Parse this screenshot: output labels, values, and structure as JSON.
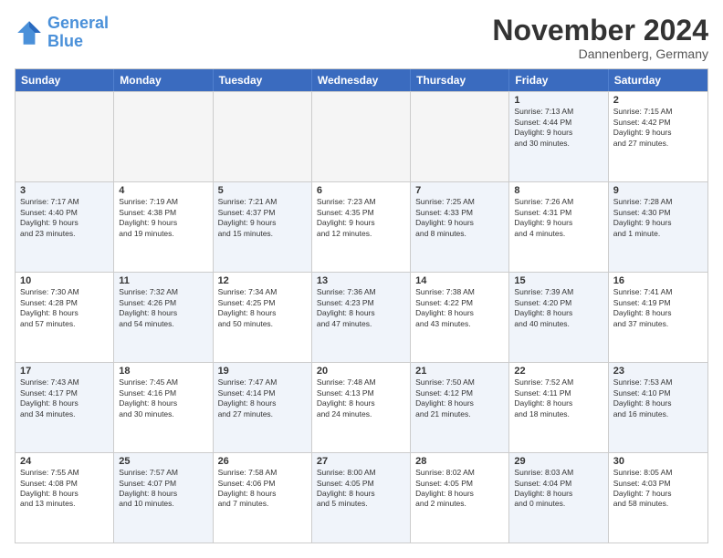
{
  "logo": {
    "line1": "General",
    "line2": "Blue"
  },
  "header": {
    "title": "November 2024",
    "subtitle": "Dannenberg, Germany"
  },
  "weekdays": [
    "Sunday",
    "Monday",
    "Tuesday",
    "Wednesday",
    "Thursday",
    "Friday",
    "Saturday"
  ],
  "weeks": [
    [
      {
        "day": "",
        "info": "",
        "empty": true
      },
      {
        "day": "",
        "info": "",
        "empty": true
      },
      {
        "day": "",
        "info": "",
        "empty": true
      },
      {
        "day": "",
        "info": "",
        "empty": true
      },
      {
        "day": "",
        "info": "",
        "empty": true
      },
      {
        "day": "1",
        "info": "Sunrise: 7:13 AM\nSunset: 4:44 PM\nDaylight: 9 hours\nand 30 minutes.",
        "shaded": true
      },
      {
        "day": "2",
        "info": "Sunrise: 7:15 AM\nSunset: 4:42 PM\nDaylight: 9 hours\nand 27 minutes.",
        "shaded": false
      }
    ],
    [
      {
        "day": "3",
        "info": "Sunrise: 7:17 AM\nSunset: 4:40 PM\nDaylight: 9 hours\nand 23 minutes.",
        "shaded": true
      },
      {
        "day": "4",
        "info": "Sunrise: 7:19 AM\nSunset: 4:38 PM\nDaylight: 9 hours\nand 19 minutes.",
        "shaded": false
      },
      {
        "day": "5",
        "info": "Sunrise: 7:21 AM\nSunset: 4:37 PM\nDaylight: 9 hours\nand 15 minutes.",
        "shaded": true
      },
      {
        "day": "6",
        "info": "Sunrise: 7:23 AM\nSunset: 4:35 PM\nDaylight: 9 hours\nand 12 minutes.",
        "shaded": false
      },
      {
        "day": "7",
        "info": "Sunrise: 7:25 AM\nSunset: 4:33 PM\nDaylight: 9 hours\nand 8 minutes.",
        "shaded": true
      },
      {
        "day": "8",
        "info": "Sunrise: 7:26 AM\nSunset: 4:31 PM\nDaylight: 9 hours\nand 4 minutes.",
        "shaded": false
      },
      {
        "day": "9",
        "info": "Sunrise: 7:28 AM\nSunset: 4:30 PM\nDaylight: 9 hours\nand 1 minute.",
        "shaded": true
      }
    ],
    [
      {
        "day": "10",
        "info": "Sunrise: 7:30 AM\nSunset: 4:28 PM\nDaylight: 8 hours\nand 57 minutes.",
        "shaded": false
      },
      {
        "day": "11",
        "info": "Sunrise: 7:32 AM\nSunset: 4:26 PM\nDaylight: 8 hours\nand 54 minutes.",
        "shaded": true
      },
      {
        "day": "12",
        "info": "Sunrise: 7:34 AM\nSunset: 4:25 PM\nDaylight: 8 hours\nand 50 minutes.",
        "shaded": false
      },
      {
        "day": "13",
        "info": "Sunrise: 7:36 AM\nSunset: 4:23 PM\nDaylight: 8 hours\nand 47 minutes.",
        "shaded": true
      },
      {
        "day": "14",
        "info": "Sunrise: 7:38 AM\nSunset: 4:22 PM\nDaylight: 8 hours\nand 43 minutes.",
        "shaded": false
      },
      {
        "day": "15",
        "info": "Sunrise: 7:39 AM\nSunset: 4:20 PM\nDaylight: 8 hours\nand 40 minutes.",
        "shaded": true
      },
      {
        "day": "16",
        "info": "Sunrise: 7:41 AM\nSunset: 4:19 PM\nDaylight: 8 hours\nand 37 minutes.",
        "shaded": false
      }
    ],
    [
      {
        "day": "17",
        "info": "Sunrise: 7:43 AM\nSunset: 4:17 PM\nDaylight: 8 hours\nand 34 minutes.",
        "shaded": true
      },
      {
        "day": "18",
        "info": "Sunrise: 7:45 AM\nSunset: 4:16 PM\nDaylight: 8 hours\nand 30 minutes.",
        "shaded": false
      },
      {
        "day": "19",
        "info": "Sunrise: 7:47 AM\nSunset: 4:14 PM\nDaylight: 8 hours\nand 27 minutes.",
        "shaded": true
      },
      {
        "day": "20",
        "info": "Sunrise: 7:48 AM\nSunset: 4:13 PM\nDaylight: 8 hours\nand 24 minutes.",
        "shaded": false
      },
      {
        "day": "21",
        "info": "Sunrise: 7:50 AM\nSunset: 4:12 PM\nDaylight: 8 hours\nand 21 minutes.",
        "shaded": true
      },
      {
        "day": "22",
        "info": "Sunrise: 7:52 AM\nSunset: 4:11 PM\nDaylight: 8 hours\nand 18 minutes.",
        "shaded": false
      },
      {
        "day": "23",
        "info": "Sunrise: 7:53 AM\nSunset: 4:10 PM\nDaylight: 8 hours\nand 16 minutes.",
        "shaded": true
      }
    ],
    [
      {
        "day": "24",
        "info": "Sunrise: 7:55 AM\nSunset: 4:08 PM\nDaylight: 8 hours\nand 13 minutes.",
        "shaded": false
      },
      {
        "day": "25",
        "info": "Sunrise: 7:57 AM\nSunset: 4:07 PM\nDaylight: 8 hours\nand 10 minutes.",
        "shaded": true
      },
      {
        "day": "26",
        "info": "Sunrise: 7:58 AM\nSunset: 4:06 PM\nDaylight: 8 hours\nand 7 minutes.",
        "shaded": false
      },
      {
        "day": "27",
        "info": "Sunrise: 8:00 AM\nSunset: 4:05 PM\nDaylight: 8 hours\nand 5 minutes.",
        "shaded": true
      },
      {
        "day": "28",
        "info": "Sunrise: 8:02 AM\nSunset: 4:05 PM\nDaylight: 8 hours\nand 2 minutes.",
        "shaded": false
      },
      {
        "day": "29",
        "info": "Sunrise: 8:03 AM\nSunset: 4:04 PM\nDaylight: 8 hours\nand 0 minutes.",
        "shaded": true
      },
      {
        "day": "30",
        "info": "Sunrise: 8:05 AM\nSunset: 4:03 PM\nDaylight: 7 hours\nand 58 minutes.",
        "shaded": false
      }
    ]
  ]
}
